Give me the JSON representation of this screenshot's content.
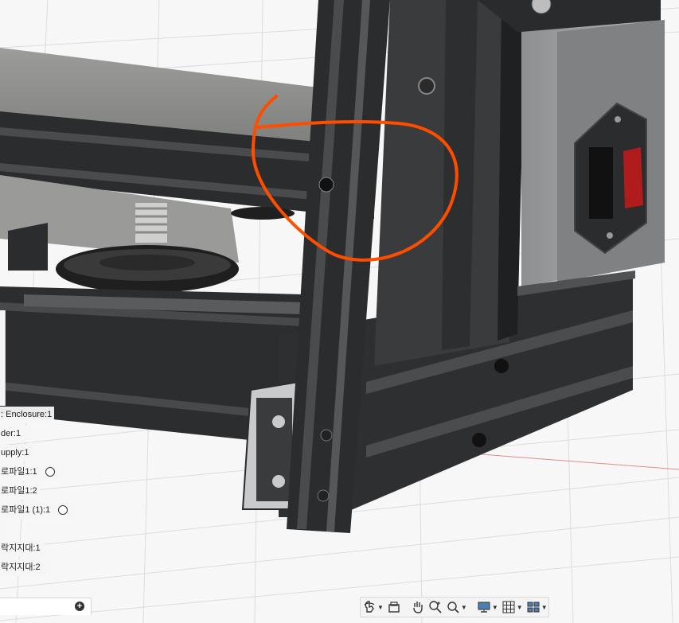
{
  "browser": {
    "rows": [
      {
        "label": ": Enclosure:1",
        "has_toggle": false
      },
      {
        "label": "der:1",
        "has_toggle": false
      },
      {
        "label": "upply:1",
        "has_toggle": false
      },
      {
        "label": "로파일1:1",
        "has_toggle": true
      },
      {
        "label": "로파일1:2",
        "has_toggle": false
      },
      {
        "label": "로파일1 (1):1",
        "has_toggle": true
      },
      {
        "label": "",
        "has_toggle": false
      },
      {
        "label": "락지지대:1",
        "has_toggle": false
      },
      {
        "label": "락지지대:2",
        "has_toggle": false
      }
    ]
  },
  "toolbar": {
    "buttons": [
      {
        "name": "orbit-icon",
        "has_caret": true
      },
      {
        "name": "look-at-icon",
        "has_caret": false
      },
      {
        "name": "pan-icon",
        "has_caret": false
      },
      {
        "name": "zoom-icon",
        "has_caret": false
      },
      {
        "name": "fit-icon",
        "has_caret": true
      },
      {
        "name": "display-settings-icon",
        "has_caret": true
      },
      {
        "name": "grid-icon",
        "has_caret": true
      },
      {
        "name": "viewports-icon",
        "has_caret": true
      }
    ]
  },
  "colors": {
    "annotation": "#ff4d00",
    "switch": "#b01c1c",
    "extrusion": "#2a2b2c",
    "canvas": "#f7f7f8",
    "grid": "#d9d9dc",
    "axis_red": "#e58a8a"
  }
}
